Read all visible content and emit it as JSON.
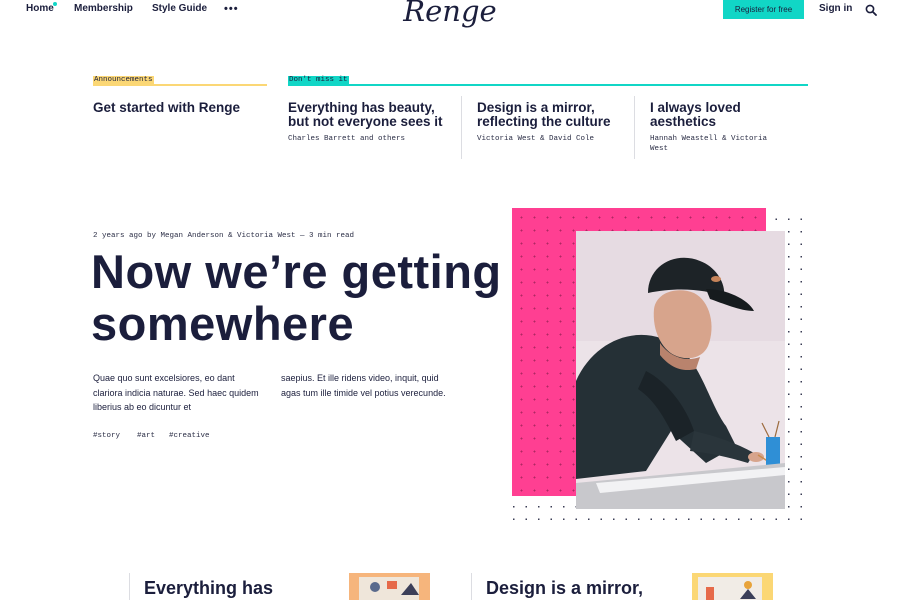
{
  "nav": {
    "home": "Home",
    "membership": "Membership",
    "style_guide": "Style Guide",
    "more": "•••",
    "brand": "Renge",
    "register": "Register for free",
    "signin": "Sign in"
  },
  "featured": {
    "announcements_label": "Announcements",
    "dont_miss_label": "Don't miss it",
    "items": [
      {
        "title": "Get started with Renge",
        "authors": ""
      },
      {
        "title": "Everything has beauty, but not everyone sees it",
        "authors": "Charles Barrett and others"
      },
      {
        "title": "Design is a mirror, reflecting the culture",
        "authors": "Victoria West & David Cole"
      },
      {
        "title": "I always loved aesthetics",
        "authors": "Hannah Weastell & Victoria West"
      }
    ]
  },
  "hero": {
    "meta": "2 years ago by Megan Anderson & Victoria West — 3 min read",
    "title": "Now we’re getting somewhere",
    "para1": "Quae quo sunt excelsiores, eo dant clariora indicia naturae. Sed haec quidem liberius ab eo dicuntur et",
    "para2": "saepius. Et ille ridens video, inquit, quid agas tum ille timide vel potius verecunde.",
    "tags": [
      "#story",
      "#art",
      "#creative"
    ]
  },
  "bottom": {
    "items": [
      {
        "title": "Everything has"
      },
      {
        "title": "Design is a mirror,"
      }
    ]
  },
  "colors": {
    "accent": "#11d6c6",
    "announcement": "#fbd775",
    "pink": "#ff3f92",
    "ink": "#1b1e3c"
  }
}
